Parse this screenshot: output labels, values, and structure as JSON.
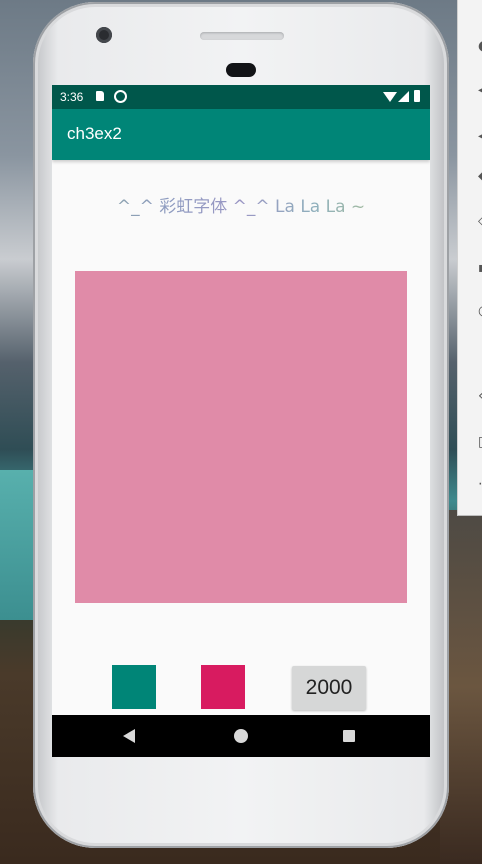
{
  "status_bar": {
    "time": "3:36",
    "icons": [
      "sd-card-icon",
      "sync-icon",
      "wifi-icon",
      "cell-signal-icon",
      "battery-icon"
    ]
  },
  "app_bar": {
    "title": "ch3ex2",
    "color": "#008577"
  },
  "content": {
    "rainbow_text": "^_^ 彩虹字体 ^_^ La La La ~",
    "preview_color": "#e08ba8",
    "swatches": [
      {
        "name": "teal",
        "color": "#008577"
      },
      {
        "name": "pink",
        "color": "#d81b60"
      }
    ],
    "duration_button_label": "2000"
  },
  "nav_bar": {
    "icons": [
      "back-icon",
      "home-icon",
      "recents-icon"
    ]
  }
}
